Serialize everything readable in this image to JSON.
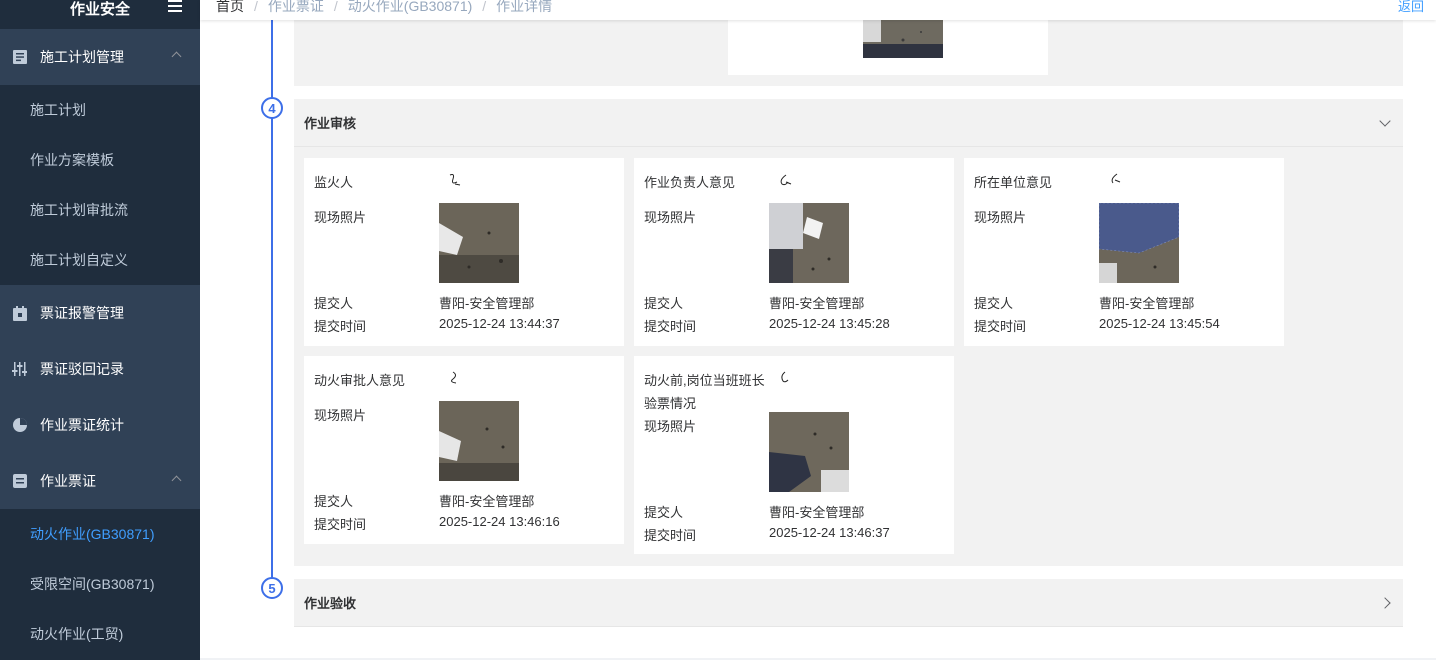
{
  "sidebar": {
    "title": "作业安全",
    "groups": [
      {
        "label": "施工计划管理",
        "icon": "list-icon",
        "items": [
          "施工计划",
          "作业方案模板",
          "施工计划审批流",
          "施工计划自定义"
        ]
      },
      {
        "label": "票证报警管理",
        "icon": "calendar-icon"
      },
      {
        "label": "票证驳回记录",
        "icon": "sliders-icon"
      },
      {
        "label": "作业票证统计",
        "icon": "pie-chart-icon"
      },
      {
        "label": "作业票证",
        "icon": "ticket-icon",
        "items": [
          "动火作业(GB30871)",
          "受限空间(GB30871)",
          "动火作业(工贸)"
        ],
        "active": "动火作业(GB30871)"
      }
    ]
  },
  "breadcrumb": [
    "首页",
    "作业票证",
    "动火作业(GB30871)",
    "作业详情"
  ],
  "back_label": "返回",
  "steps": [
    {
      "number": "4",
      "title": "作业审核",
      "expanded": true,
      "cards": [
        {
          "label": "监火人",
          "photo_label": "现场照片",
          "submitter_label": "提交人",
          "submitter": "曹阳-安全管理部",
          "time_label": "提交时间",
          "time": "2025-12-24 13:44:37"
        },
        {
          "label": "作业负责人意见",
          "photo_label": "现场照片",
          "submitter_label": "提交人",
          "submitter": "曹阳-安全管理部",
          "time_label": "提交时间",
          "time": "2025-12-24 13:45:28"
        },
        {
          "label": "所在单位意见",
          "photo_label": "现场照片",
          "submitter_label": "提交人",
          "submitter": "曹阳-安全管理部",
          "time_label": "提交时间",
          "time": "2025-12-24 13:45:54"
        },
        {
          "label": "动火审批人意见",
          "photo_label": "现场照片",
          "submitter_label": "提交人",
          "submitter": "曹阳-安全管理部",
          "time_label": "提交时间",
          "time": "2025-12-24 13:46:16"
        },
        {
          "label_line1": "动火前,岗位当班班长",
          "label_line2": "验票情况",
          "photo_label": "现场照片",
          "submitter_label": "提交人",
          "submitter": "曹阳-安全管理部",
          "time_label": "提交时间",
          "time": "2025-12-24 13:46:37"
        }
      ]
    },
    {
      "number": "5",
      "title": "作业验收",
      "expanded": false
    }
  ],
  "colors": {
    "accent": "#3d6fe8",
    "link": "#409eff",
    "sidebar_bg": "#1f2d3d"
  }
}
